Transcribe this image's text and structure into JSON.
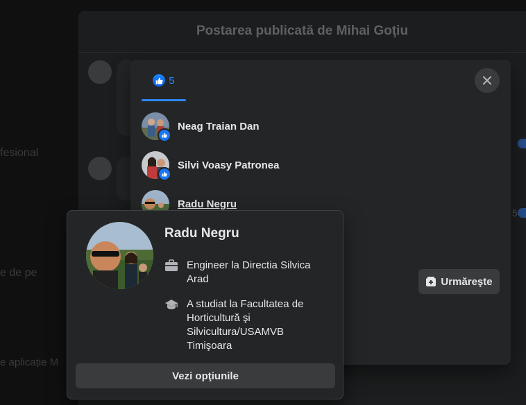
{
  "background": {
    "left_texts": [
      "fesional",
      "e de pe",
      "e aplicație M"
    ],
    "post_dialog_title": "Postarea publicată de Mihai Goţiu",
    "right_count": "5"
  },
  "reactions_modal": {
    "tab_all": {
      "icon": "like-icon",
      "count": "5"
    },
    "people": [
      {
        "name": "Neag Traian Dan",
        "reaction": "like"
      },
      {
        "name": "Silvi Voasy Patronea",
        "reaction": "like"
      },
      {
        "name": "Radu Negru",
        "reaction": "like"
      }
    ],
    "follow_button_label": "Urmăreşte"
  },
  "hover_card": {
    "name": "Radu Negru",
    "work": "Engineer la Directia Silvica Arad",
    "education": "A studiat la Facultatea de Horticultură şi Silvicultura/USAMVB Timişoara",
    "options_button_label": "Vezi opţiunile"
  },
  "colors": {
    "accent": "#2d88ff",
    "modal_bg": "#242526",
    "button_bg": "#3a3b3c",
    "text": "#e4e6eb"
  }
}
